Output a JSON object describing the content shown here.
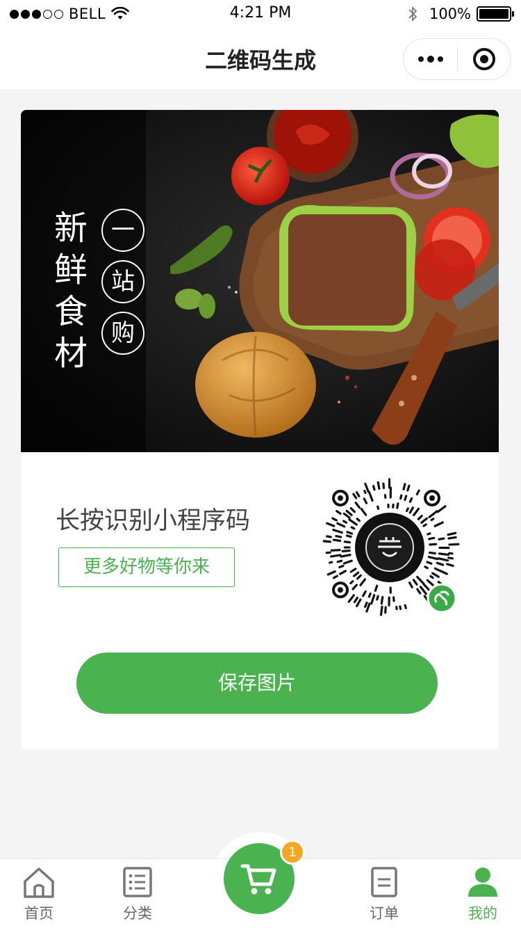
{
  "status_bar": {
    "carrier": "BELL",
    "time": "4:21 PM",
    "battery": "100%",
    "signal_bars_filled": 3,
    "signal_bars_total": 5
  },
  "nav": {
    "title": "二维码生成"
  },
  "banner": {
    "slogan_vertical": "新鲜食材",
    "slogan_circles": [
      "一",
      "站",
      "购"
    ]
  },
  "share": {
    "prompt": "长按识别小程序码",
    "tag": "更多好物等你来"
  },
  "save_button": {
    "label": "保存图片"
  },
  "tab_bar": {
    "items": [
      {
        "label": "首页",
        "icon": "home-icon",
        "active": false
      },
      {
        "label": "分类",
        "icon": "list-icon",
        "active": false
      },
      {
        "label": "订单",
        "icon": "order-icon",
        "active": false
      },
      {
        "label": "我的",
        "icon": "user-icon",
        "active": true
      }
    ],
    "cart_badge": "1"
  },
  "colors": {
    "accent": "#4ab34f",
    "badge": "#f5a623",
    "background": "#f4f4f4"
  }
}
